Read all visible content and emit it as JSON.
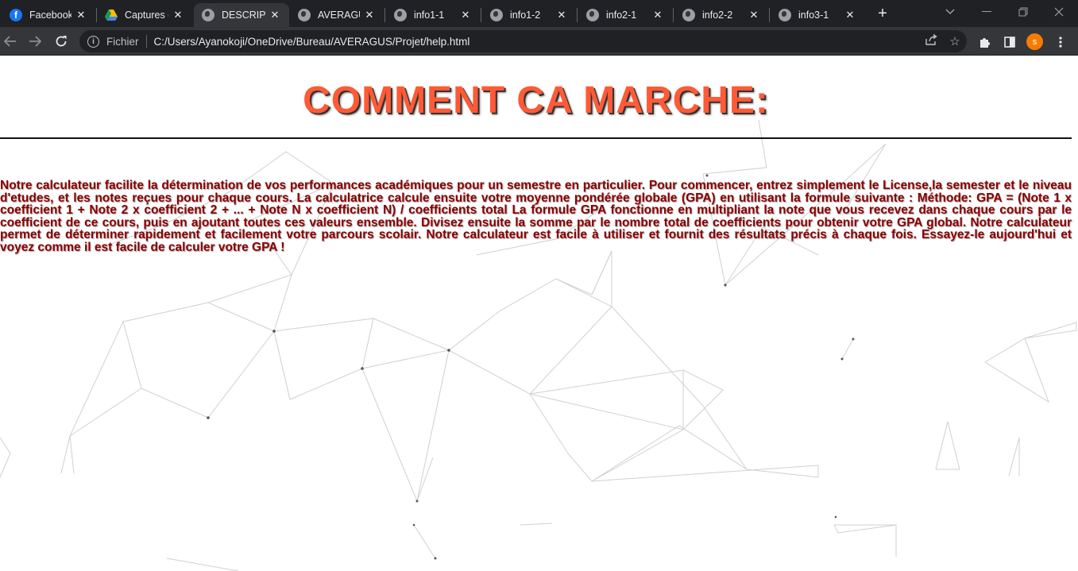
{
  "browser": {
    "tabs": [
      {
        "title": "Facebook",
        "icon": "facebook-icon",
        "active": false
      },
      {
        "title": "Captures d",
        "icon": "google-drive-icon",
        "active": false
      },
      {
        "title": "DESCRIPTI",
        "icon": "globe-icon",
        "active": true
      },
      {
        "title": "AVERAGUS",
        "icon": "globe-icon",
        "active": false
      },
      {
        "title": "info1-1",
        "icon": "globe-icon",
        "active": false
      },
      {
        "title": "info1-2",
        "icon": "globe-icon",
        "active": false
      },
      {
        "title": "info2-1",
        "icon": "globe-icon",
        "active": false
      },
      {
        "title": "info2-2",
        "icon": "globe-icon",
        "active": false
      },
      {
        "title": "info3-1",
        "icon": "globe-icon",
        "active": false
      }
    ],
    "new_tab_label": "+",
    "facebook_letter": "f",
    "scheme_label": "Fichier",
    "url": "C:/Users/Ayanokoji/OneDrive/Bureau/AVERAGUS/Projet/help.html",
    "profile_initial": "s",
    "colors": {
      "tab_strip": "#202124",
      "toolbar": "#35363a",
      "profile": "#f57c00"
    }
  },
  "page": {
    "title": "COMMENT CA MARCHE:",
    "body": "Notre calculateur facilite la détermination de vos performances académiques pour un semestre en particulier. Pour commencer, entrez simplement le License,la semester et le niveau d'etudes, et les notes reçues pour chaque cours. La calculatrice calcule ensuite votre moyenne pondérée globale (GPA) en utilisant la formule suivante : Méthode: GPA = (Note 1 x coefficient 1 + Note 2 x coefficient 2 + ... + Note N x coefficient N) / coefficients total La formule GPA fonctionne en multipliant la note que vous recevez dans chaque cours par le coefficient de ce cours, puis en ajoutant toutes ces valeurs ensemble. Divisez ensuite la somme par le nombre total de coefficients pour obtenir votre GPA global. Notre calculateur permet de déterminer rapidement et facilement votre parcours scolair. Notre calculateur est facile à utiliser et fournit des résultats précis à chaque fois. Essayez-le aujourd'hui et voyez comme il est facile de calculer votre GPA !",
    "colors": {
      "title": "#ff5a36",
      "body": "#8b0000",
      "rule": "#111111"
    }
  }
}
